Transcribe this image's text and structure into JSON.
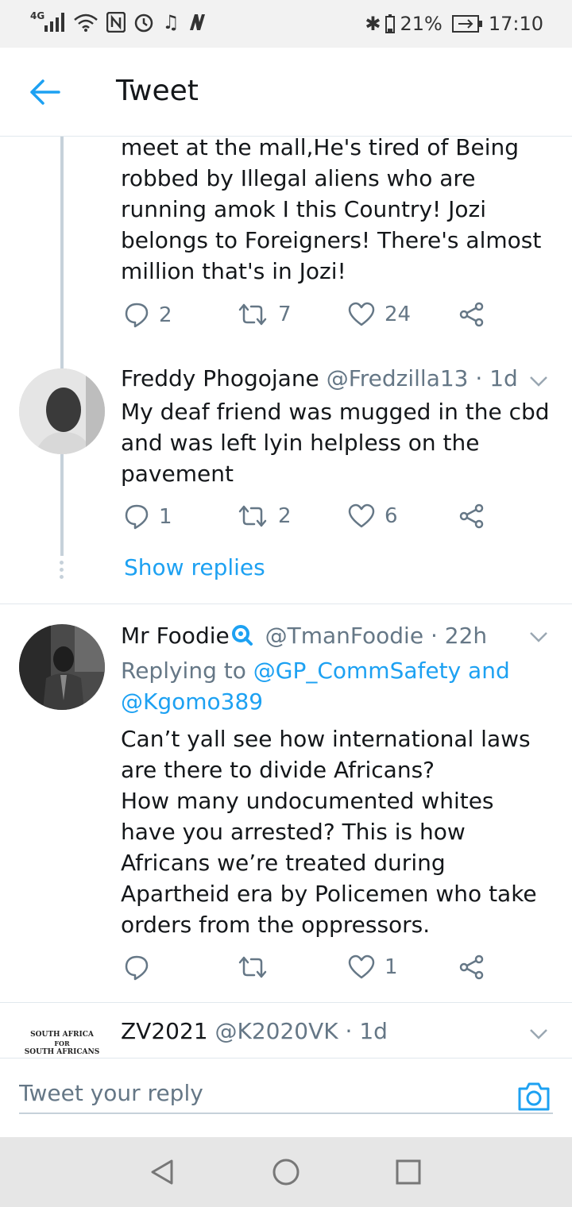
{
  "status_bar": {
    "network": "4G",
    "battery_percent": "21%",
    "time": "17:10",
    "icons": [
      "signal-icon",
      "wifi-icon",
      "nfc-icon",
      "alarm-icon",
      "music-icon",
      "notification-icon",
      "bluetooth-icon",
      "battery-icon"
    ]
  },
  "header": {
    "title": "Tweet",
    "back_icon": "arrow-left-icon"
  },
  "colors": {
    "accent": "#1da1f2",
    "secondary_text": "#657786",
    "thread_line": "#c6d1da"
  },
  "tweets": [
    {
      "text": "meet at the mall,He's tired of Being robbed by Illegal aliens who are running amok I this Country! Jozi belongs to Foreigners! There's almost million that's in Jozi!",
      "replies": "2",
      "retweets": "7",
      "likes": "24"
    },
    {
      "name": "Freddy Phogojane",
      "handle": "@Fredzilla13 · 1d",
      "text": "My deaf friend was mugged in the cbd and was left lyin helpless on the pavement",
      "replies": "1",
      "retweets": "2",
      "likes": "6",
      "show_replies": "Show replies"
    },
    {
      "name": "Mr Foodie",
      "handle": "@TmanFoodie · 22h",
      "replying_prefix": "Replying to ",
      "replying_users": "@GP_CommSafety and @Kgomo389",
      "text": "Can’t yall see how international laws are there to divide Africans?\nHow many undocumented whites have you arrested? This is how Africans we’re treated during Apartheid era by Policemen who take orders from the oppressors.",
      "replies": "",
      "retweets": "",
      "likes": "1"
    },
    {
      "name": "ZV2021",
      "handle": "@K2020VK · 1d",
      "avatar_text": [
        "SOUTH AFRICA",
        "FOR",
        "SOUTH AFRICANS"
      ]
    }
  ],
  "reply_bar": {
    "placeholder": "Tweet your reply"
  }
}
